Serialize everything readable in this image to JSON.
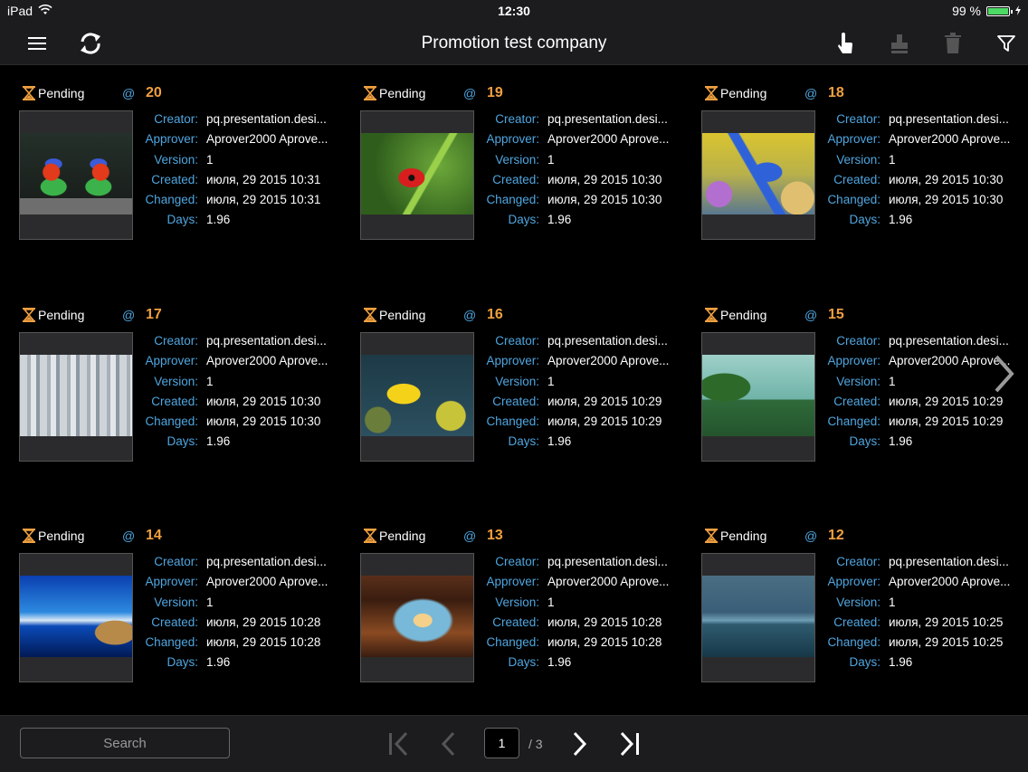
{
  "statusbar": {
    "carrier": "iPad",
    "time": "12:30",
    "battery": "99 %",
    "battery_level": 0.99
  },
  "navbar": {
    "title": "Promotion test company"
  },
  "labels": {
    "creator": "Creator:",
    "approver": "Approver:",
    "version": "Version:",
    "created": "Created:",
    "changed": "Changed:",
    "days": "Days:",
    "at": "@"
  },
  "items": [
    {
      "status": "Pending",
      "number": "20",
      "creator": "pq.presentation.desi...",
      "approver": "Aprover2000 Aprove...",
      "version": "1",
      "created": "июля, 29 2015 10:31",
      "changed": "июля, 29 2015 10:31",
      "days": "1.96",
      "image": "parrots"
    },
    {
      "status": "Pending",
      "number": "19",
      "creator": "pq.presentation.desi...",
      "approver": "Aprover2000 Aprove...",
      "version": "1",
      "created": "июля, 29 2015 10:30",
      "changed": "июля, 29 2015 10:30",
      "days": "1.96",
      "image": "ladybug"
    },
    {
      "status": "Pending",
      "number": "18",
      "creator": "pq.presentation.desi...",
      "approver": "Aprover2000 Aprove...",
      "version": "1",
      "created": "июля, 29 2015 10:30",
      "changed": "июля, 29 2015 10:30",
      "days": "1.96",
      "image": "starfish"
    },
    {
      "status": "Pending",
      "number": "17",
      "creator": "pq.presentation.desi...",
      "approver": "Aprover2000 Aprove...",
      "version": "1",
      "created": "июля, 29 2015 10:30",
      "changed": "июля, 29 2015 10:30",
      "days": "1.96",
      "image": "city"
    },
    {
      "status": "Pending",
      "number": "16",
      "creator": "pq.presentation.desi...",
      "approver": "Aprover2000 Aprove...",
      "version": "1",
      "created": "июля, 29 2015 10:29",
      "changed": "июля, 29 2015 10:29",
      "days": "1.96",
      "image": "fish"
    },
    {
      "status": "Pending",
      "number": "15",
      "creator": "pq.presentation.desi...",
      "approver": "Aprover2000 Aprove...",
      "version": "1",
      "created": "июля, 29 2015 10:29",
      "changed": "июля, 29 2015 10:29",
      "days": "1.96",
      "image": "lake"
    },
    {
      "status": "Pending",
      "number": "14",
      "creator": "pq.presentation.desi...",
      "approver": "Aprover2000 Aprove...",
      "version": "1",
      "created": "июля, 29 2015 10:28",
      "changed": "июля, 29 2015 10:28",
      "days": "1.96",
      "image": "beach"
    },
    {
      "status": "Pending",
      "number": "13",
      "creator": "pq.presentation.desi...",
      "approver": "Aprover2000 Aprove...",
      "version": "1",
      "created": "июля, 29 2015 10:28",
      "changed": "июля, 29 2015 10:28",
      "days": "1.96",
      "image": "cave"
    },
    {
      "status": "Pending",
      "number": "12",
      "creator": "pq.presentation.desi...",
      "approver": "Aprover2000 Aprove...",
      "version": "1",
      "created": "июля, 29 2015 10:25",
      "changed": "июля, 29 2015 10:25",
      "days": "1.96",
      "image": "skyline"
    }
  ],
  "bottombar": {
    "search_placeholder": "Search",
    "page_current": "1",
    "page_total": "/ 3"
  },
  "icons": {
    "menu": "menu-icon",
    "refresh": "refresh-icon",
    "touch": "touch-icon",
    "stamp": "stamp-icon",
    "trash": "trash-icon",
    "filter": "filter-icon",
    "status": "hourglass-icon"
  },
  "colors": {
    "background": "#000000",
    "bar": "#1c1c1e",
    "label": "#4fa6e0",
    "number": "#f0a040",
    "status_icon": "#f0a040",
    "disabled": "#555555"
  }
}
